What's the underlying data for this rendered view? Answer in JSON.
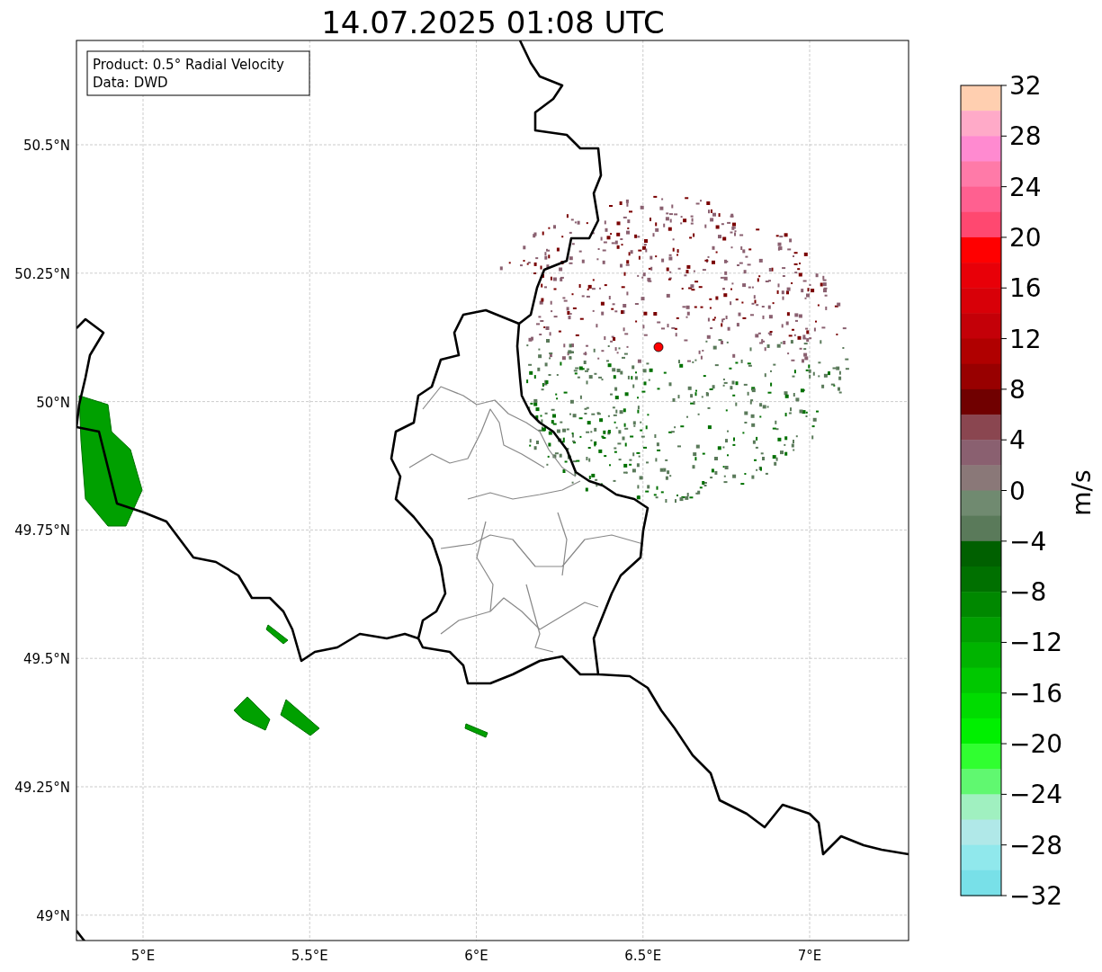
{
  "title": "14.07.2025 01:08 UTC",
  "legend": [
    "Product: 0.5° Radial Velocity",
    "Data: DWD"
  ],
  "axes": {
    "yticks": [
      "50.5°N",
      "50.25°N",
      "50°N",
      "49.75°N",
      "49.5°N",
      "49.25°N",
      "49°N"
    ],
    "xticks": [
      "5°E",
      "5.5°E",
      "6°E",
      "6.5°E",
      "7°E"
    ]
  },
  "colorbar": {
    "label": "m/s",
    "ticks": [
      "32",
      "28",
      "24",
      "20",
      "16",
      "12",
      "8",
      "4",
      "0",
      "−4",
      "−8",
      "−12",
      "−16",
      "−20",
      "−24",
      "−28",
      "−32"
    ],
    "segments": [
      {
        "color": "#ffcfb0"
      },
      {
        "color": "#ffaac8"
      },
      {
        "color": "#ff8ad0"
      },
      {
        "color": "#ff7aa8"
      },
      {
        "color": "#ff6090"
      },
      {
        "color": "#ff4870"
      },
      {
        "color": "#ff0000"
      },
      {
        "color": "#e80008"
      },
      {
        "color": "#d80008"
      },
      {
        "color": "#c40008"
      },
      {
        "color": "#b00000"
      },
      {
        "color": "#980000"
      },
      {
        "color": "#700000"
      },
      {
        "color": "#8a4650"
      },
      {
        "color": "#8a6070"
      },
      {
        "color": "#8a7878"
      },
      {
        "color": "#708a70"
      },
      {
        "color": "#5a7a5a"
      },
      {
        "color": "#006000"
      },
      {
        "color": "#007000"
      },
      {
        "color": "#008800"
      },
      {
        "color": "#00a000"
      },
      {
        "color": "#00b400"
      },
      {
        "color": "#00c800"
      },
      {
        "color": "#00dc00"
      },
      {
        "color": "#00f000"
      },
      {
        "color": "#30ff30"
      },
      {
        "color": "#60f870"
      },
      {
        "color": "#a0f0c0"
      },
      {
        "color": "#b0e8e8"
      },
      {
        "color": "#90e8ec"
      },
      {
        "color": "#78e0e8"
      }
    ]
  }
}
